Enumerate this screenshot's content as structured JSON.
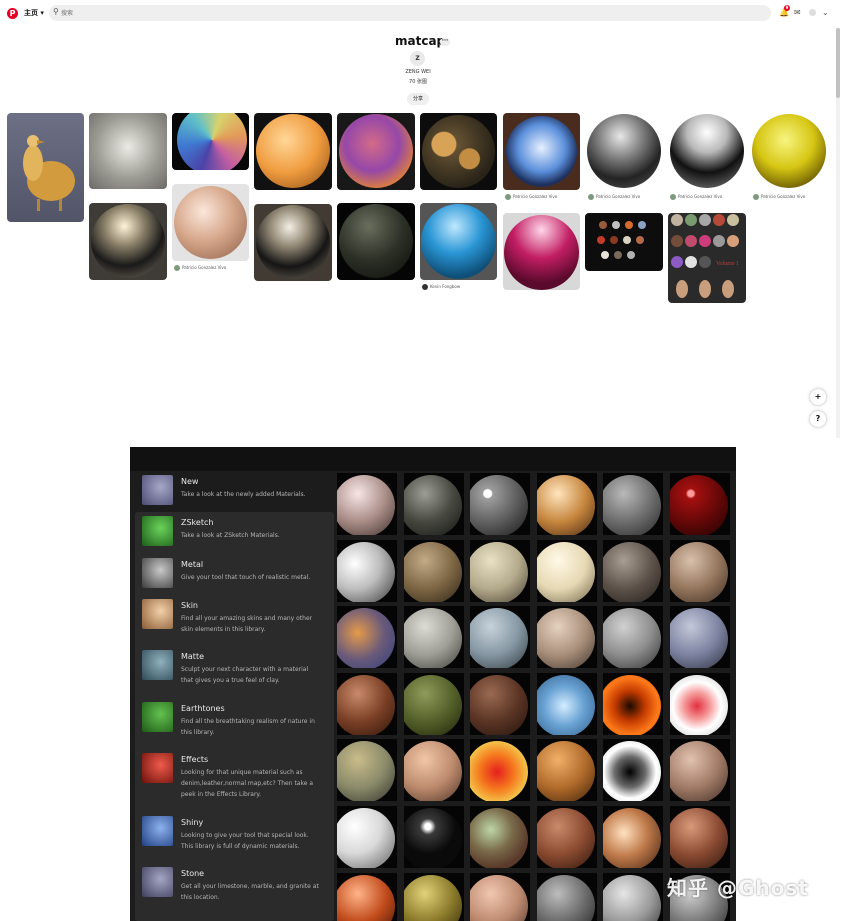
{
  "topbar": {
    "logo": "P",
    "home_label": "主页 ▾",
    "search_placeholder": "搜索",
    "notification_count": "9"
  },
  "board": {
    "title": "matcap",
    "more": "···",
    "avatar_initial": "Z",
    "owner": "ZENG WEI",
    "pin_count": "70 张图",
    "share_label": "分享"
  },
  "pins": [
    {
      "name": "pin-bird-sculpture",
      "caption": ""
    },
    {
      "name": "pin-blurry-gray",
      "caption": ""
    },
    {
      "name": "pin-rainbow",
      "caption": ""
    },
    {
      "name": "pin-orange",
      "caption": ""
    },
    {
      "name": "pin-purple-orange",
      "caption": ""
    },
    {
      "name": "pin-camo",
      "caption": ""
    },
    {
      "name": "pin-fisheye-sky",
      "caption": "Patricio Gonzalez Vivo"
    },
    {
      "name": "pin-dark-chrome",
      "caption": "Patricio Gonzalez Vivo"
    },
    {
      "name": "pin-silver",
      "caption": "Patricio Gonzalez Vivo"
    },
    {
      "name": "pin-yellow",
      "caption": "Patricio Gonzalez Vivo"
    },
    {
      "name": "pin-chrome-gold",
      "caption": ""
    },
    {
      "name": "pin-skin",
      "caption": "Patricio Gonzalez Vivo"
    },
    {
      "name": "pin-chrome-dark",
      "caption": ""
    },
    {
      "name": "pin-dark-green",
      "caption": ""
    },
    {
      "name": "pin-blue",
      "caption": "Kevin Fongbow"
    },
    {
      "name": "pin-magenta",
      "caption": ""
    },
    {
      "name": "pin-small-spheres",
      "caption": ""
    },
    {
      "name": "pin-volume-sheet",
      "caption": ""
    }
  ],
  "fab": {
    "add": "+",
    "help": "?"
  },
  "library": {
    "categories": [
      {
        "name": "New",
        "desc": "Take a look at the newly added Materials."
      },
      {
        "name": "ZSketch",
        "desc": "Take a look at ZSketch Materials."
      },
      {
        "name": "Metal",
        "desc": "Give your tool that touch of realistic metal."
      },
      {
        "name": "Skin",
        "desc": "Find all your amazing skins and many other skin elements in this library."
      },
      {
        "name": "Matte",
        "desc": "Sculpt your next character with a material that gives you a true feel of clay."
      },
      {
        "name": "Earthtones",
        "desc": "Find all the breathtaking realism of nature in this library."
      },
      {
        "name": "Effects",
        "desc": "Looking for that unique material such as denim,leather,normal map,etc? Then take a peek in the Effects Library."
      },
      {
        "name": "Shiny",
        "desc": "Looking to give your tool that special look. This library is full of dynamic materials."
      },
      {
        "name": "Stone",
        "desc": "Get all your limestone, marble, and granite at this location."
      }
    ]
  },
  "colors": {
    "brand": "#e60023",
    "library_bg": "#1c1c1c",
    "panel_bg": "#2b2b2b"
  },
  "watermark": "知乎 @Ghost"
}
